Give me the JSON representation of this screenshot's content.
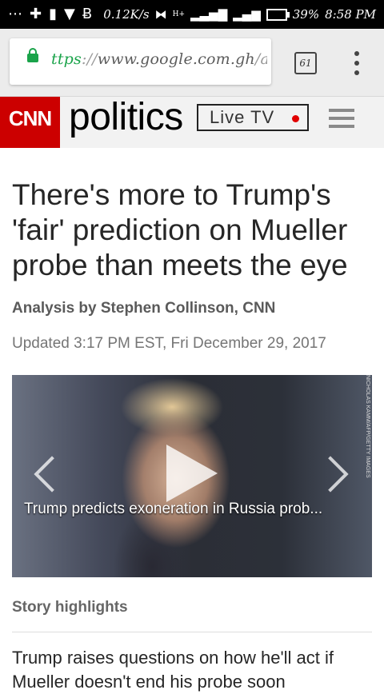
{
  "status_bar": {
    "left_icons": [
      "more-dots-icon",
      "plus-icon",
      "alert-icon",
      "shield-icon",
      "bitcoin-icon"
    ],
    "net_speed": "0.12K/s",
    "signal_label": "H+",
    "battery_percent": "39%",
    "time": "8:58 PM"
  },
  "browser": {
    "url_scheme": "ttps",
    "url_sep": "://",
    "url_host": "www.google.com.gh",
    "url_path": "/a",
    "tab_count": "61"
  },
  "site_header": {
    "logo_text": "CNN",
    "section_title": "politics",
    "live_tv_label": "Live TV"
  },
  "article": {
    "headline": "There's more to Trump's 'fair' prediction on Mueller probe than meets the eye",
    "byline": "Analysis by Stephen Collinson, CNN",
    "updated": "Updated 3:17 PM EST, Fri December 29, 2017",
    "video": {
      "caption": "Trump predicts exoneration in Russia prob...",
      "photo_credit": "NICHOLAS KAMM/AFP/GETTY IMAGES"
    },
    "highlights_label": "Story highlights",
    "highlight_1": "Trump raises questions on how he'll act if Mueller doesn't end his probe soon"
  },
  "colors": {
    "cnn_red": "#cc0000",
    "secure_green": "#1aa34a",
    "live_dot": "#e10000"
  }
}
